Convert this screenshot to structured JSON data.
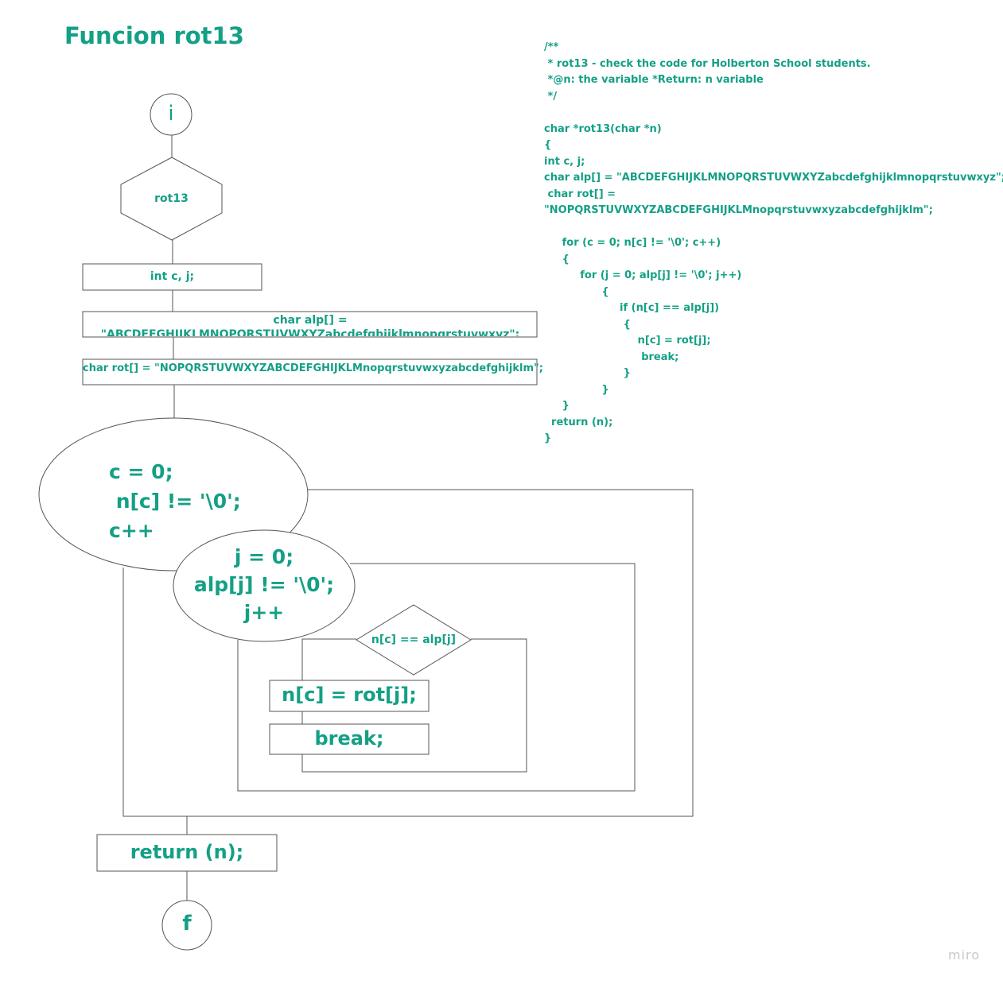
{
  "title": "Funcion rot13",
  "flowchart": {
    "start": "i",
    "function_name": "rot13",
    "declare_vars": "int c, j;",
    "alp_line1": "char alp[] =",
    "alp_line2": "\"ABCDEFGHIJKLMNOPQRSTUVWXYZabcdefghijklmnopqrstuvwxyz\";",
    "rot_decl": "char rot[] = \"NOPQRSTUVWXYZABCDEFGHIJKLMnopqrstuvwxyzabcdefghijklm\";",
    "outer_loop": [
      "c = 0;",
      " n[c] != '\\0';",
      "c++"
    ],
    "inner_loop": [
      "j = 0;",
      "alp[j] != '\\0';",
      "j++"
    ],
    "condition": "n[c] == alp[j]",
    "assign": "n[c] = rot[j];",
    "break_stmt": "break;",
    "return_stmt": "return (n);",
    "end": "f"
  },
  "code_lines": [
    "/**",
    " * rot13 - check the code for Holberton School students.",
    " *@n: the variable *Return: n variable",
    " */",
    "",
    "char *rot13(char *n)",
    "{",
    "int c, j;",
    "char alp[] = \"ABCDEFGHIJKLMNOPQRSTUVWXYZabcdefghijklmnopqrstuvwxyz\";",
    " char rot[] =",
    "\"NOPQRSTUVWXYZABCDEFGHIJKLMnopqrstuvwxyzabcdefghijklm\";",
    "",
    "     for (c = 0; n[c] != '\\0'; c++)",
    "     {",
    "          for (j = 0; alp[j] != '\\0'; j++)",
    "                {",
    "                     if (n[c] == alp[j])",
    "                      {",
    "                          n[c] = rot[j];",
    "                           break;",
    "                      }",
    "                }",
    "     }",
    "  return (n);",
    "}"
  ],
  "watermark": "miro",
  "colors": {
    "accent": "#14a085",
    "stroke": "#555555",
    "watermark": "#c8c8c8"
  }
}
